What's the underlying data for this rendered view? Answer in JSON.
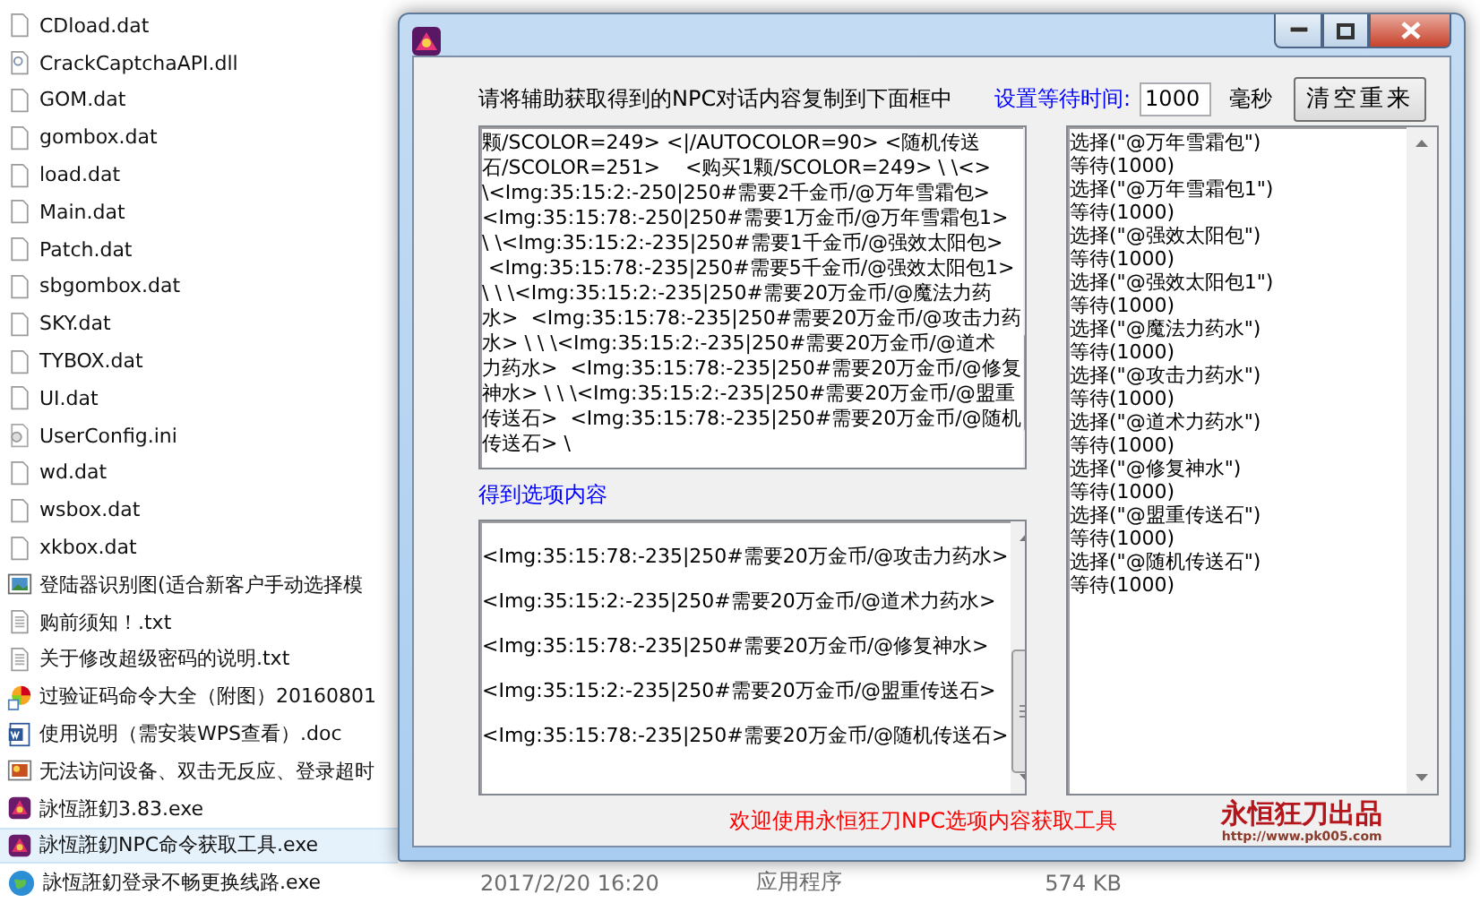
{
  "explorer": {
    "files": [
      {
        "name": "CDload.dat",
        "kind": "blank",
        "selected": false
      },
      {
        "name": "CrackCaptchaAPI.dll",
        "kind": "dll",
        "selected": false
      },
      {
        "name": "GOM.dat",
        "kind": "blank",
        "selected": false
      },
      {
        "name": "gombox.dat",
        "kind": "blank",
        "selected": false
      },
      {
        "name": "load.dat",
        "kind": "blank",
        "selected": false
      },
      {
        "name": "Main.dat",
        "kind": "blank",
        "selected": false
      },
      {
        "name": "Patch.dat",
        "kind": "blank",
        "selected": false
      },
      {
        "name": "sbgombox.dat",
        "kind": "blank",
        "selected": false
      },
      {
        "name": "SKY.dat",
        "kind": "blank",
        "selected": false
      },
      {
        "name": "TYBOX.dat",
        "kind": "blank",
        "selected": false
      },
      {
        "name": "UI.dat",
        "kind": "blank",
        "selected": false
      },
      {
        "name": "UserConfig.ini",
        "kind": "ini",
        "selected": false
      },
      {
        "name": "wd.dat",
        "kind": "blank",
        "selected": false
      },
      {
        "name": "wsbox.dat",
        "kind": "blank",
        "selected": false
      },
      {
        "name": "xkbox.dat",
        "kind": "blank",
        "selected": false
      },
      {
        "name": "登陆器识别图(适合新客户手动选择模",
        "kind": "image",
        "selected": false
      },
      {
        "name": "购前须知！.txt",
        "kind": "text",
        "selected": false
      },
      {
        "name": "关于修改超级密码的说明.txt",
        "kind": "text",
        "selected": false
      },
      {
        "name": "过验证码命令大全（附图）20160801",
        "kind": "shortcut",
        "selected": false
      },
      {
        "name": "使用说明（需安装WPS查看）.doc",
        "kind": "word",
        "selected": false
      },
      {
        "name": "无法访问设备、双击无反应、登录超时",
        "kind": "picture",
        "selected": false
      },
      {
        "name": "詠恆誑釖3.83.exe",
        "kind": "app",
        "selected": false
      },
      {
        "name": "詠恆誑釖NPC命令获取工具.exe",
        "kind": "app",
        "selected": true
      },
      {
        "name": "詠恆誑釖登录不畅更换线路.exe",
        "kind": "globe",
        "selected": false,
        "date": "2017/2/20 16:20",
        "type": "应用程序",
        "size": "574 KB"
      }
    ]
  },
  "window": {
    "instruction": "请将辅助获取得到的NPC对话内容复制到下面框中",
    "wait_label": "设置等待时间:",
    "wait_value": "1000",
    "wait_unit": "毫秒",
    "clear_button": "清空重来",
    "input_lines": [
      "颗/SCOLOR=249> <|/AUTOCOLOR=90> <随机传送",
      "石/SCOLOR=251>    <购买1颗/SCOLOR=249> \\ \\<>",
      "\\<Img:35:15:2:-250|250#需要2千金币/@万年雪霜包>",
      "<Img:35:15:78:-250|250#需要1万金币/@万年雪霜包1>",
      "\\ \\<Img:35:15:2:-235|250#需要1千金币/@强效太阳包>",
      " <Img:35:15:78:-235|250#需要5千金币/@强效太阳包1>",
      "\\ \\ \\<Img:35:15:2:-235|250#需要20万金币/@魔法力药",
      "水>  <Img:35:15:78:-235|250#需要20万金币/@攻击力药",
      "水> \\ \\ \\<Img:35:15:2:-235|250#需要20万金币/@道术",
      "力药水>  <Img:35:15:78:-235|250#需要20万金币/@修复",
      "神水> \\ \\ \\<Img:35:15:2:-235|250#需要20万金币/@盟重",
      "传送石>  <Img:35:15:78:-235|250#需要20万金币/@随机",
      "传送石> \\"
    ],
    "options_label": "得到选项内容",
    "options": [
      "<Img:35:15:78:-235|250#需要20万金币/@攻击力药水>",
      "<Img:35:15:2:-235|250#需要20万金币/@道术力药水>",
      "<Img:35:15:78:-235|250#需要20万金币/@修复神水>",
      "<Img:35:15:2:-235|250#需要20万金币/@盟重传送石>",
      "<Img:35:15:78:-235|250#需要20万金币/@随机传送石>"
    ],
    "script_lines": [
      "选择(\"@万年雪霜包\")",
      "等待(1000)",
      "选择(\"@万年雪霜包1\")",
      "等待(1000)",
      "选择(\"@强效太阳包\")",
      "等待(1000)",
      "选择(\"@强效太阳包1\")",
      "等待(1000)",
      "选择(\"@魔法力药水\")",
      "等待(1000)",
      "选择(\"@攻击力药水\")",
      "等待(1000)",
      "选择(\"@道术力药水\")",
      "等待(1000)",
      "选择(\"@修复神水\")",
      "等待(1000)",
      "选择(\"@盟重传送石\")",
      "等待(1000)",
      "选择(\"@随机传送石\")",
      "等待(1000)"
    ],
    "footer": "欢迎使用永恒狂刀NPC选项内容获取工具",
    "logo": "永恒**狂刀**出品",
    "logo_url": "http://www.pk005.com"
  }
}
